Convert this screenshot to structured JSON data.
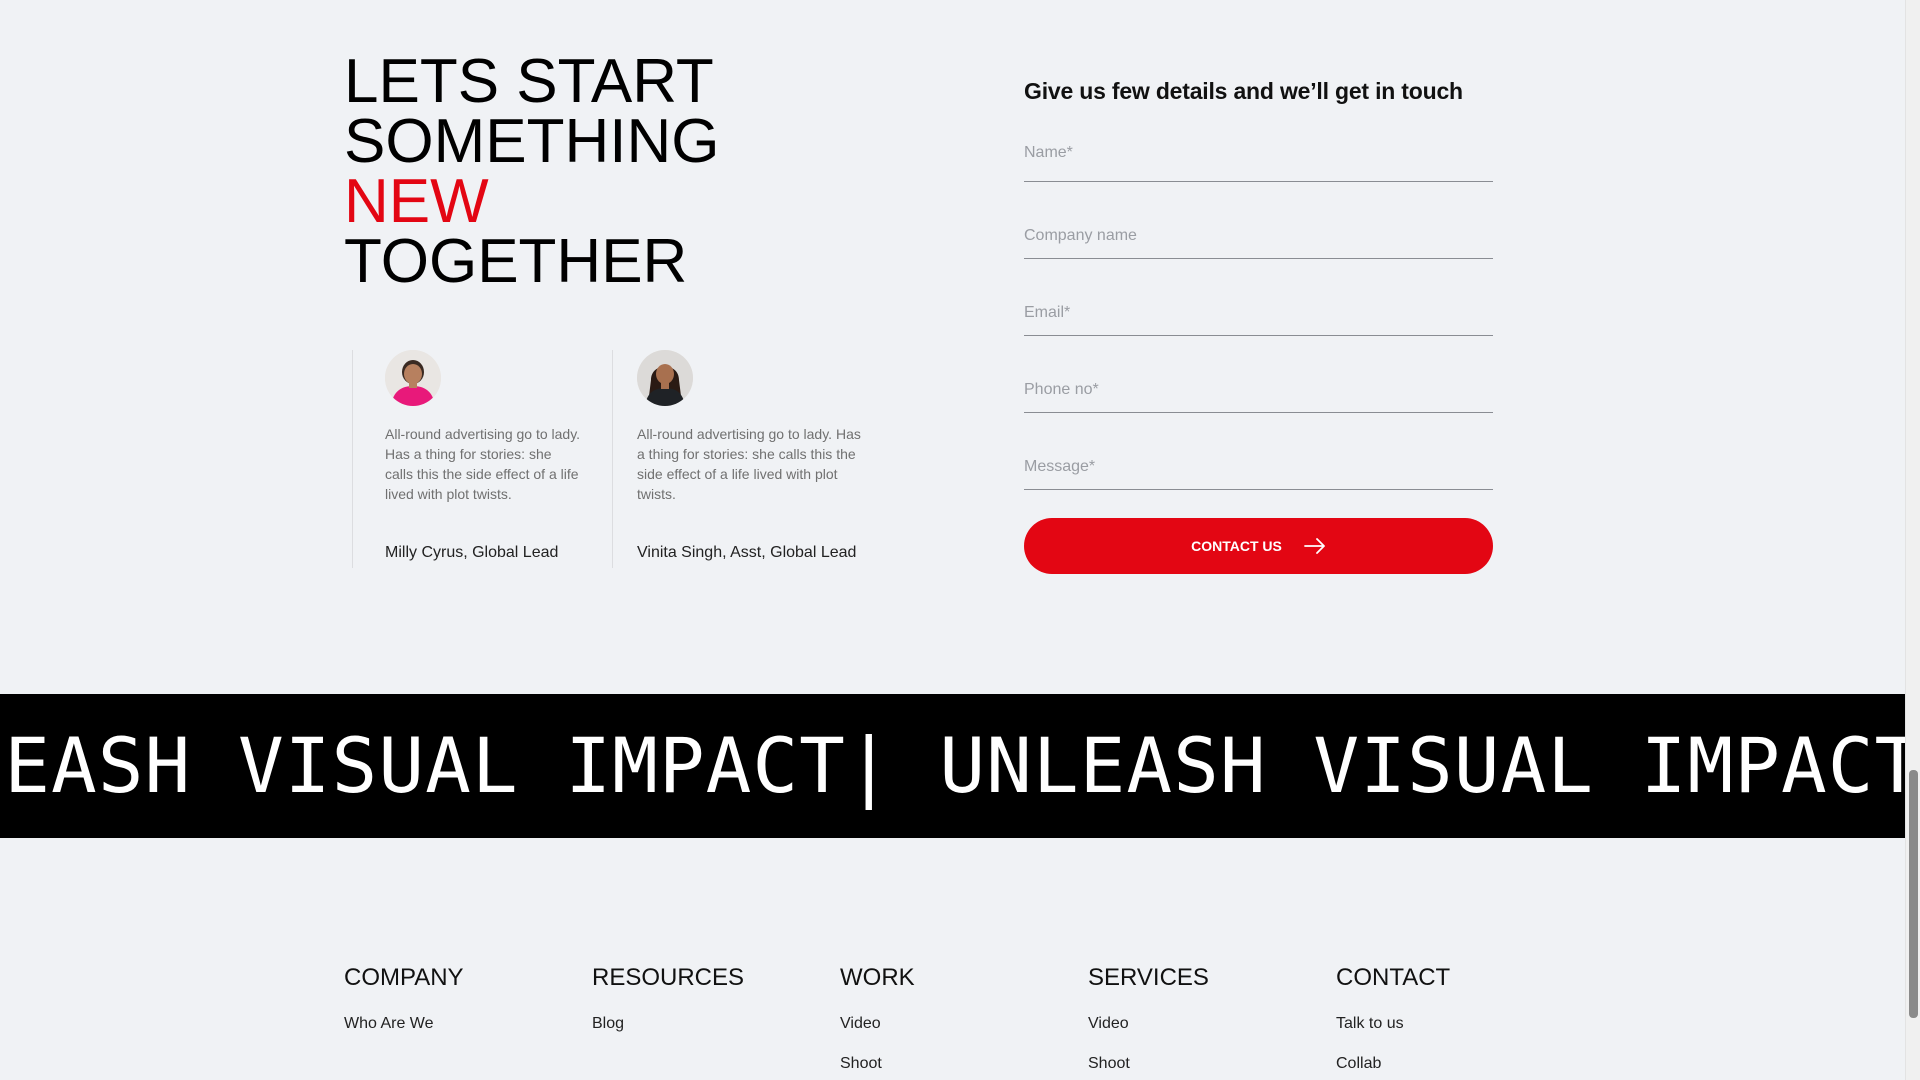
{
  "hero": {
    "line1": "LETS START",
    "line2": "SOMETHING",
    "line3": "NEW",
    "line4": "TOGETHER",
    "accent_color": "#e30613"
  },
  "testimonials": [
    {
      "quote": "All-round advertising go to lady. Has a thing for stories: she calls this the side effect of a life lived with plot twists.",
      "author": "Milly Cyrus, Global Lead",
      "avatar_icon": "avatar-woman-pink-top"
    },
    {
      "quote": "All-round advertising go to lady. Has a thing for stories: she calls this the side effect of a life lived with plot twists.",
      "author": "Vinita Singh, Asst, Global Lead",
      "avatar_icon": "avatar-woman-dark-top"
    }
  ],
  "form": {
    "heading": "Give us few details and we’ll get in touch",
    "name_placeholder": "Name*",
    "company_placeholder": "Company name",
    "email_placeholder": "Email*",
    "phone_placeholder": "Phone no*",
    "message_placeholder": "Message*",
    "submit_label": "CONTACT US",
    "submit_icon": "arrow-right-icon"
  },
  "marquee": {
    "text": "UNLEASH VISUAL IMPACT| UNLEASH VISUAL IMPACT |UNLEASH VISUAL IMPACT"
  },
  "footer": {
    "company": {
      "title": "COMPANY",
      "links": [
        "Who Are We"
      ]
    },
    "resources": {
      "title": "RESOURCES",
      "links": [
        "Blog"
      ]
    },
    "work": {
      "title": "WORK",
      "links": [
        "Video",
        "Shoot"
      ]
    },
    "services": {
      "title": "SERVICES",
      "links": [
        "Video",
        "Shoot"
      ]
    },
    "contact": {
      "title": "CONTACT",
      "links": [
        "Talk to us",
        "Collab"
      ]
    }
  }
}
